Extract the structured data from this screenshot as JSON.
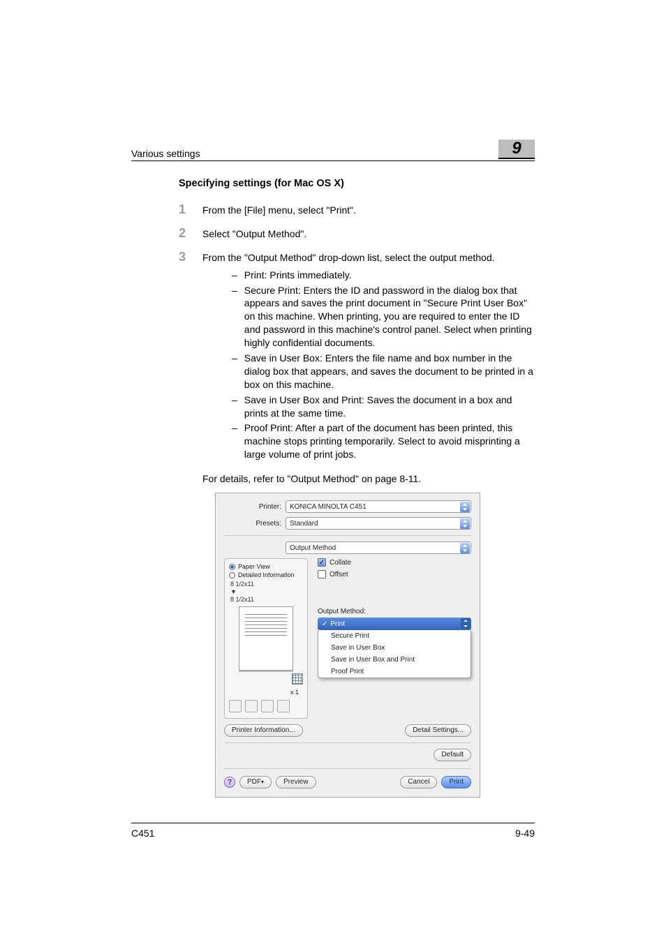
{
  "header": {
    "running_title": "Various settings",
    "chapter_number": "9"
  },
  "subheading": "Specifying settings (for Mac OS X)",
  "steps": [
    {
      "num": "1",
      "text": "From the [File] menu, select \"Print\"."
    },
    {
      "num": "2",
      "text": "Select \"Output Method\"."
    },
    {
      "num": "3",
      "text": "From the \"Output Method\" drop-down list, select the output method."
    }
  ],
  "sublist": [
    "Print: Prints immediately.",
    "Secure Print: Enters the ID and password in the dialog box that appears and saves the print document in \"Secure Print User Box\" on this machine. When printing, you are required to enter the ID and password in this machine's control panel. Select when printing highly confidential documents.",
    "Save in User Box: Enters the file name and box number in the dialog box that appears, and saves the document to be printed in a box on this machine.",
    "Save in User Box and Print: Saves the document in a box and prints at the same time.",
    "Proof Print: After a part of the document has been printed, this machine stops printing temporarily. Select to avoid misprinting a large volume of print jobs."
  ],
  "details_line": "For details, refer to \"Output Method\" on page 8-11.",
  "dialog": {
    "printer_label": "Printer:",
    "printer_value": "KONICA MINOLTA C451",
    "presets_label": "Presets:",
    "presets_value": "Standard",
    "pane_value": "Output Method",
    "paper_view": "Paper View",
    "detailed_info": "Detailed Information",
    "paper_dim1": "8 1/2x11",
    "paper_dim2": "8 1/2x11",
    "x1": "x 1",
    "collate": "Collate",
    "offset": "Offset",
    "output_method_label": "Output Method:",
    "om_options": [
      "Print",
      "Secure Print",
      "Save in User Box",
      "Save in User Box and Print",
      "Proof Print"
    ],
    "printer_info_btn": "Printer Information...",
    "detail_settings_btn": "Detail Settings...",
    "default_btn": "Default",
    "pdf_btn": "PDF",
    "preview_btn": "Preview",
    "cancel_btn": "Cancel",
    "print_btn": "Print"
  },
  "footer": {
    "model": "C451",
    "page": "9-49"
  }
}
